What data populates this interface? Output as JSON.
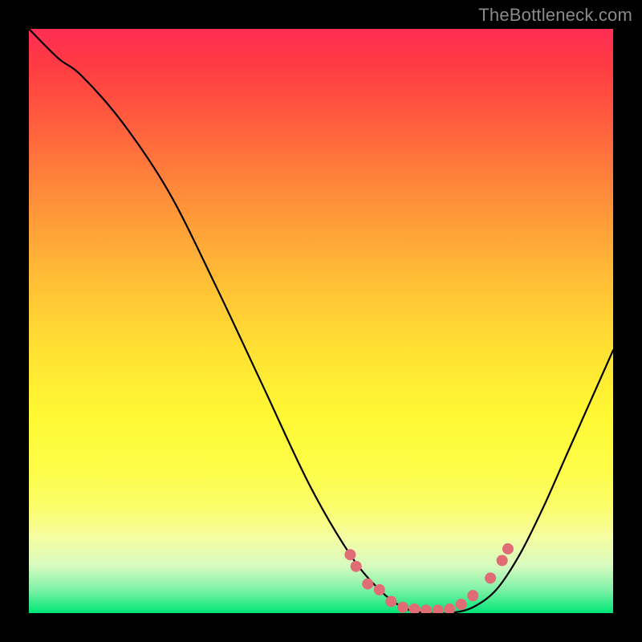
{
  "watermark": "TheBottleneck.com",
  "frame_color": "#000000",
  "gradient_stops": [
    {
      "pct": 0,
      "color": "#ff2d55"
    },
    {
      "pct": 6,
      "color": "#ff3b43"
    },
    {
      "pct": 15,
      "color": "#ff5a3e"
    },
    {
      "pct": 28,
      "color": "#ff8b3a"
    },
    {
      "pct": 42,
      "color": "#ffbb36"
    },
    {
      "pct": 55,
      "color": "#ffe133"
    },
    {
      "pct": 66,
      "color": "#fff833"
    },
    {
      "pct": 76,
      "color": "#fdfd4a"
    },
    {
      "pct": 82,
      "color": "#fbfd6c"
    },
    {
      "pct": 87,
      "color": "#f6fda1"
    },
    {
      "pct": 92,
      "color": "#d6fbc0"
    },
    {
      "pct": 96,
      "color": "#7df1a6"
    },
    {
      "pct": 100,
      "color": "#00e676"
    }
  ],
  "chart_data": {
    "type": "line",
    "title": "",
    "xlabel": "",
    "ylabel": "",
    "xlim": [
      0,
      100
    ],
    "ylim": [
      0,
      100
    ],
    "x": [
      0,
      5,
      9,
      16,
      24,
      32,
      40,
      48,
      55,
      60,
      64,
      68,
      72,
      76,
      80,
      84,
      88,
      92,
      96,
      100
    ],
    "values": [
      100,
      95,
      92,
      84,
      72,
      56,
      39,
      22,
      10,
      4,
      1,
      0,
      0,
      1,
      4,
      10,
      18,
      27,
      36,
      45
    ],
    "dots": {
      "color": "#e06c75",
      "x": [
        55,
        56,
        58,
        60,
        62,
        64,
        66,
        68,
        70,
        72,
        74,
        76,
        79,
        81,
        82
      ],
      "y": [
        10,
        8,
        5,
        4,
        2,
        1,
        0.7,
        0.5,
        0.5,
        0.7,
        1.5,
        3,
        6,
        9,
        11
      ]
    }
  }
}
